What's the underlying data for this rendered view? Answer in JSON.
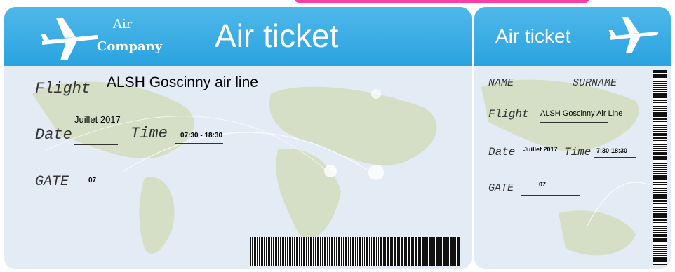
{
  "main": {
    "company_line1": "Air",
    "company_line2": "Company",
    "title": "Air ticket",
    "flight_label": "Flight",
    "flight_value": "ALSH Goscinny air line",
    "date_label": "Date",
    "date_value": "Juillet 2017",
    "time_label": "Time",
    "time_value": "07:30 - 18:30",
    "gate_label": "GATE",
    "gate_value": "07"
  },
  "stub": {
    "title": "Air ticket",
    "name_label": "NAME",
    "surname_label": "SURNAME",
    "flight_label": "Flight",
    "flight_value": "ALSH Goscinny Air Line",
    "date_label": "Date",
    "date_value": "Juillet 2017",
    "time_label": "Time",
    "time_value": "7:30-18:30",
    "gate_label": "GATE",
    "gate_value": "07"
  },
  "colors": {
    "header": "#2aa3df",
    "accent_pink": "#ff3ea5",
    "map_water": "#e6eef5",
    "land": "#c9d9b2"
  }
}
